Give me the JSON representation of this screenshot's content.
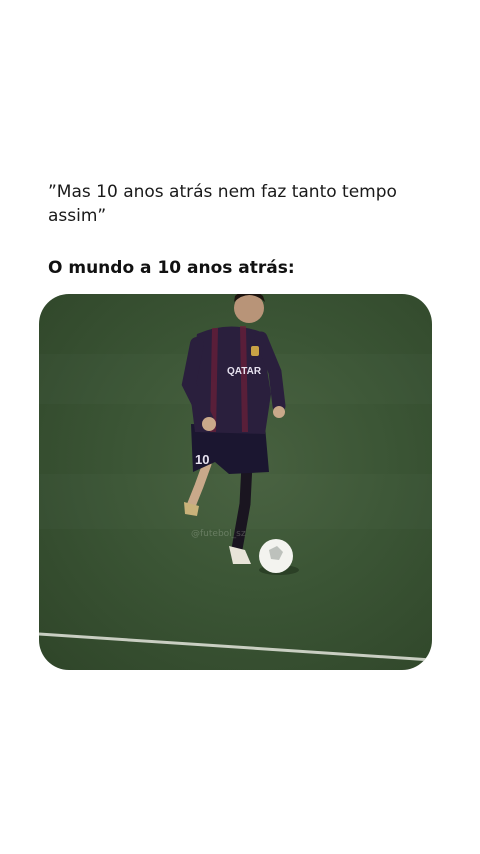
{
  "post": {
    "quote": "”Mas 10 anos atrás nem faz tanto tempo assim”",
    "subhead": "O mundo a 10 anos atrás:"
  },
  "media": {
    "shirt_sponsor": "QATAR",
    "shirt_number": "10",
    "watermark": "@futebol_sz"
  },
  "colors": {
    "pitch": "#3b5535",
    "shirt": "#2a1f3d",
    "shorts": "#1b1630",
    "text": "#111111"
  }
}
